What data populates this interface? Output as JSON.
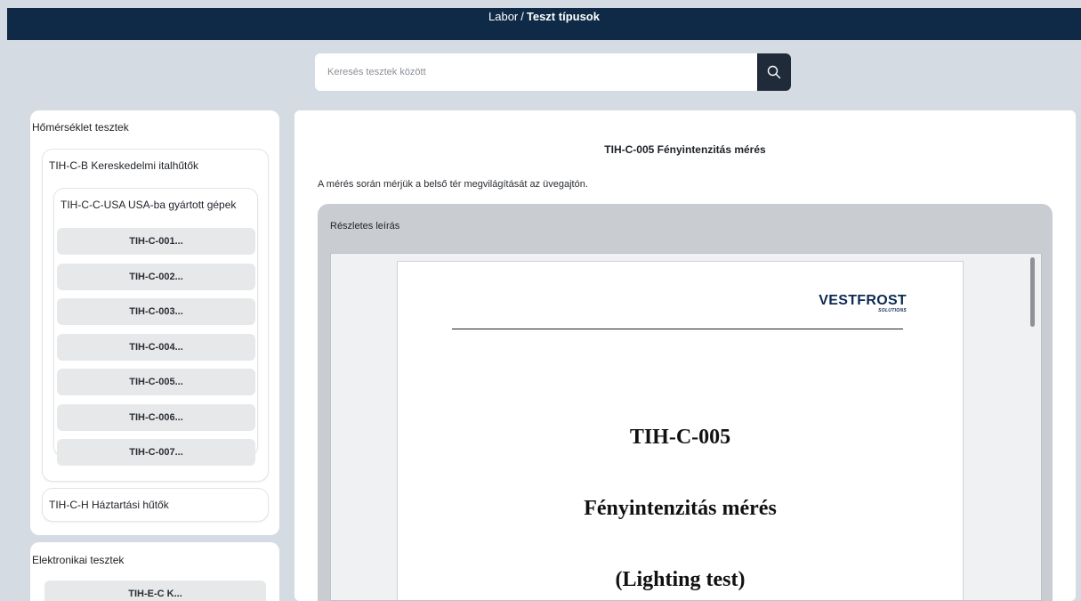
{
  "header": {
    "breadcrumb_root": "Labor",
    "breadcrumb_sep": "/",
    "breadcrumb_current": "Teszt típusok"
  },
  "search": {
    "placeholder": "Keresés tesztek között",
    "button_icon": "search-icon"
  },
  "sidebar": {
    "categories": [
      {
        "title": "Hőmérséklet tesztek",
        "groups": [
          {
            "label": "TIH-C-B Kereskedelmi italhűtők",
            "subgroups": [
              {
                "label": "TIH-C-C-USA USA-ba gyártott gépek",
                "items": [
                  "TIH-C-001...",
                  "TIH-C-002...",
                  "TIH-C-003...",
                  "TIH-C-004...",
                  "TIH-C-005...",
                  "TIH-C-006...",
                  "TIH-C-007..."
                ]
              }
            ]
          },
          {
            "label": "TIH-C-H Háztartási hűtők"
          }
        ]
      },
      {
        "title": "Elektronikai tesztek",
        "items": [
          "TIH-E-C K..."
        ]
      }
    ]
  },
  "main": {
    "title": "TIH-C-005 Fényintenzitás mérés",
    "description": "A mérés során mérjük a belső tér megvilágítását az üvegajtón.",
    "detail_label": "Részletes leírás",
    "document": {
      "logo_text": "VESTFROST",
      "logo_subtext": "SOLUTIONS",
      "code": "TIH-C-005",
      "title": "Fényintenzitás mérés",
      "subtitle": "(Lighting test)"
    }
  },
  "colors": {
    "header_bg": "#0e2a46",
    "page_bg": "#d5dbe3",
    "search_button_bg": "#1f2b38",
    "item_bg": "#e7e8ea",
    "detail_bg": "#c9cdd2",
    "logo_color": "#0d2a52"
  }
}
